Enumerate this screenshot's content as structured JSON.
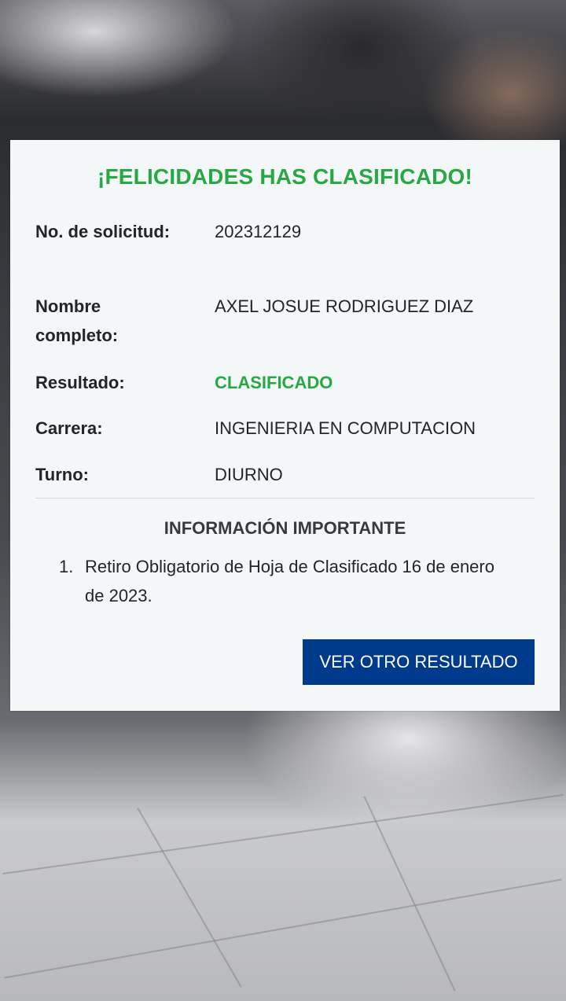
{
  "card": {
    "title": "¡FELICIDADES HAS CLASIFICADO!",
    "fields": [
      {
        "label": "No. de solicitud:",
        "value": "202312129"
      },
      {
        "label": "Nombre completo:",
        "value": "AXEL JOSUE RODRIGUEZ DIAZ"
      },
      {
        "label": "Resultado:",
        "value": "CLASIFICADO"
      },
      {
        "label": "Carrera:",
        "value": "INGENIERIA EN COMPUTACION"
      },
      {
        "label": "Turno:",
        "value": "DIURNO"
      }
    ],
    "info_title": "INFORMACIÓN IMPORTANTE",
    "info_items": [
      {
        "number": "1.",
        "text": "Retiro Obligatorio de Hoja de Clasificado 16 de enero de 2023."
      }
    ],
    "button_label": "VER OTRO RESULTADO"
  },
  "colors": {
    "success": "#28a745",
    "button": "#003a8c",
    "card_bg": "#f4f7f7"
  }
}
